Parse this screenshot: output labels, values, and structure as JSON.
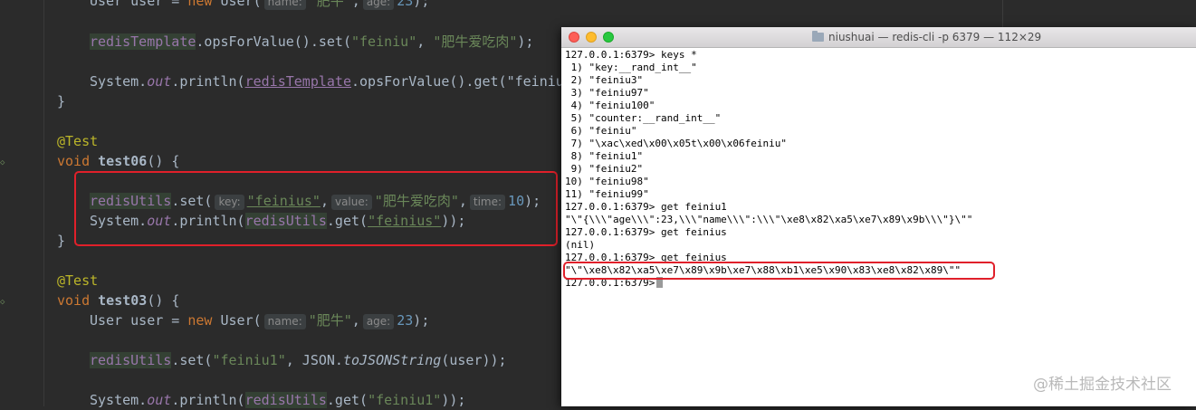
{
  "code": {
    "line1": {
      "pre": "User user = ",
      "kw": "new",
      "cls": " User(",
      "hint1": "name:",
      "str1": "\"肥牛\"",
      "comma": ",",
      "hint2": "age:",
      "num": "23",
      "end": ");"
    },
    "line2": {
      "recv": "redisTemplate",
      "m1": ".opsForValue().set(",
      "s1": "\"feiniu\"",
      "comma": ", ",
      "s2": "\"肥牛爱吃肉\"",
      "end": ");"
    },
    "line3": {
      "a": "System.",
      "b": "out",
      "c": ".println(",
      "d": "redisTemplate",
      "e": ".opsForValue().get(\"feiniu"
    },
    "line4": "}",
    "line5": "@Test",
    "line6": {
      "kw": "void",
      "name": "test06",
      "end": "() {"
    },
    "line7": {
      "recv": "redisUtils",
      "m": ".set(",
      "h1": "key:",
      "s1": "\"feinius\"",
      "comma": ",",
      "h2": "value:",
      "s2": "\"肥牛爱吃肉\"",
      "c2": ",",
      "h3": "time:",
      "n": "10",
      "end": ");"
    },
    "line8": {
      "a": "System.",
      "b": "out",
      "c": ".println(",
      "d": "redisUtils",
      "e": ".get(",
      "s": "\"feinius\"",
      "end": "));"
    },
    "line9": "}",
    "line10": "@Test",
    "line11": {
      "kw": "void",
      "name": "test03",
      "end": "() {"
    },
    "line12": {
      "pre": "User user = ",
      "kw": "new",
      "cls": " User(",
      "hint1": "name:",
      "str1": "\"肥牛\"",
      "comma": ",",
      "hint2": "age:",
      "num": "23",
      "end": ");"
    },
    "line13": {
      "recv": "redisUtils",
      "m": ".set(",
      "s1": "\"feiniu1\"",
      "mid": ", JSON.",
      "fn": "toJSONString",
      "end": "(user));"
    },
    "line14": {
      "a": "System.",
      "b": "out",
      "c": ".println(",
      "d": "redisUtils",
      "e": ".get(",
      "s": "\"feiniu1\"",
      "end": "));"
    }
  },
  "terminal": {
    "title": "niushuai — redis-cli -p 6379 — 112×29",
    "lines": [
      "127.0.0.1:6379> keys *",
      " 1) \"key:__rand_int__\"",
      " 2) \"feiniu3\"",
      " 3) \"feiniu97\"",
      " 4) \"feiniu100\"",
      " 5) \"counter:__rand_int__\"",
      " 6) \"feiniu\"",
      " 7) \"\\xac\\xed\\x00\\x05t\\x00\\x06feiniu\"",
      " 8) \"feiniu1\"",
      " 9) \"feiniu2\"",
      "10) \"feiniu98\"",
      "11) \"feiniu99\"",
      "127.0.0.1:6379> get feiniu1",
      "\"\\\"{\\\\\\\"age\\\\\\\":23,\\\\\\\"name\\\\\\\":\\\\\\\"\\xe8\\x82\\xa5\\xe7\\x89\\x9b\\\\\\\"}\\\"\"",
      "127.0.0.1:6379> get feinius",
      "(nil)",
      "127.0.0.1:6379> get feinius",
      "\"\\\"\\xe8\\x82\\xa5\\xe7\\x89\\x9b\\xe7\\x88\\xb1\\xe5\\x90\\x83\\xe8\\x82\\x89\\\"\"",
      "127.0.0.1:6379>"
    ]
  },
  "watermark": "@稀土掘金技术社区",
  "colors": {
    "highlight_box": "#e0202a",
    "editor_bg": "#2b2b2b",
    "terminal_bg": "#ffffff"
  }
}
